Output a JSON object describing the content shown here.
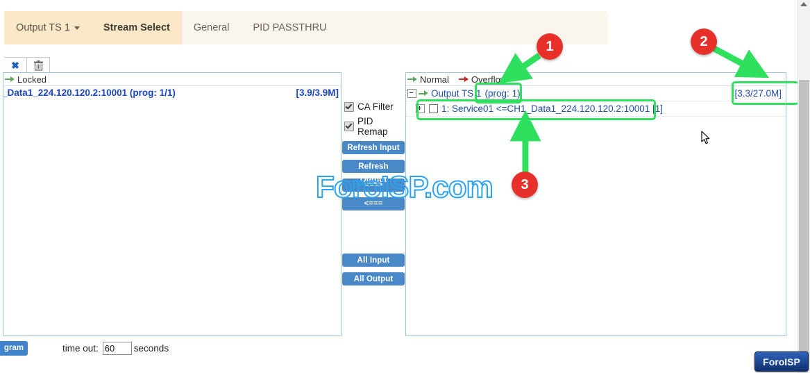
{
  "tabs": [
    {
      "label": "Output TS 1",
      "type": "dropdown",
      "icon": "chevron-down-icon"
    },
    {
      "label": "Stream Select",
      "type": "active"
    },
    {
      "label": "General",
      "type": "plain"
    },
    {
      "label": "PID PASSTHRU",
      "type": "plain"
    }
  ],
  "toolbar": {
    "close_icon": "✖",
    "close_name": "close-icon",
    "delete_icon": "🗑",
    "delete_name": "trash-icon"
  },
  "left_panel": {
    "header_label": "Locked",
    "header_icon": "green-arrow-icon",
    "rows": [
      {
        "name": "_Data1_224.120.120.2:10001 (prog: 1/1)",
        "rate": "[3.9/3.9M]"
      }
    ]
  },
  "middle_panel": {
    "checkboxes": [
      {
        "label": "CA Filter",
        "checked": true
      },
      {
        "label": "PID Remap",
        "checked": true
      }
    ],
    "buttons": [
      {
        "label": "Refresh Input",
        "name": "refresh-input-button"
      },
      {
        "label": "Refresh Output",
        "name": "refresh-output-button"
      },
      {
        "label": "===>",
        "name": "move-right-button"
      },
      {
        "label": "<===",
        "name": "move-left-button"
      },
      {
        "label": "All Input",
        "name": "all-input-button"
      },
      {
        "label": "All Output",
        "name": "all-output-button"
      }
    ]
  },
  "right_panel": {
    "legend": [
      {
        "label": "Normal",
        "color": "#5fa95f"
      },
      {
        "label": "Overflow",
        "color": "#cc2222"
      }
    ],
    "tree": {
      "root_label": "Output TS 1",
      "root_prog": "(prog: 1)",
      "root_rate": "[3.3/27.0M]",
      "child_label": "1: Service01 <=CH1_Data1_224.120.120.2:10001 [1]"
    }
  },
  "annotations": [
    {
      "number": "1",
      "target": "output-ts-prog-count"
    },
    {
      "number": "2",
      "target": "output-ts-bitrate"
    },
    {
      "number": "3",
      "target": "service-row"
    }
  ],
  "watermark": {
    "text": "ForoISP.com",
    "color": "#2aa3f0"
  },
  "bottom_bar": {
    "program_button_label": "gram",
    "timeout_label": "time out:",
    "timeout_value": "60",
    "seconds_label": "seconds"
  },
  "foroisp_badge": {
    "label": "ForoISP"
  },
  "colors": {
    "tab_active_bg": "#fae8c8",
    "tab_bar_bg": "#faf6ee",
    "panel_border": "#9fc4dd",
    "link_blue": "#1b45c4",
    "button_blue": "#4a89c8",
    "highlight_green": "#2fe05e",
    "badge_red": "#e8302a"
  }
}
